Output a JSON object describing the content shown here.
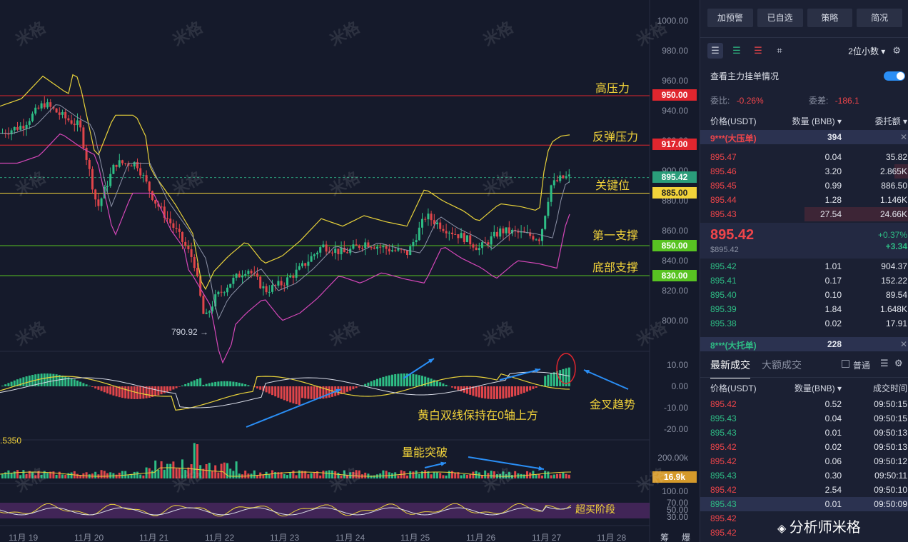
{
  "chart": {
    "price_axis": [
      "1000.00",
      "980.00",
      "960.00",
      "940.00",
      "920.00",
      "900.00",
      "880.00",
      "860.00",
      "840.00",
      "820.00",
      "800.00"
    ],
    "macd_axis": [
      "10.00",
      "0.00",
      "-10.00",
      "-20.00"
    ],
    "vol_axis": [
      "200.00k"
    ],
    "vol_value": "16.9k",
    "rsi_axis": [
      "100.00",
      "70.00",
      "50.00",
      "30.00"
    ],
    "x_labels": [
      "11月 19",
      "11月 20",
      "11月 21",
      "11月 22",
      "11月 23",
      "11月 24",
      "11月 25",
      "11月 26",
      "11月 27",
      "11月 28"
    ],
    "corner_labels": [
      "筹",
      "爆"
    ],
    "low_marker": "790.92 →",
    "left_value": ".5350",
    "levels": [
      {
        "label": "950.00",
        "color": "#e0262e"
      },
      {
        "label": "917.00",
        "color": "#e0262e"
      },
      {
        "label": "895.42",
        "color": "#2a9d7a"
      },
      {
        "label": "885.00",
        "color": "#f2d33a"
      },
      {
        "label": "850.00",
        "color": "#58c322"
      },
      {
        "label": "830.00",
        "color": "#58c322"
      }
    ],
    "annotations": {
      "high_pressure": "高压力",
      "rebound_pressure": "反弹压力",
      "key_level": "关键位",
      "support_one": "第一支撑",
      "support_bottom": "底部支撑",
      "golden_cross": "金叉趋势",
      "double_line": "黄白双线保持在0轴上方",
      "volume_break": "量能突破",
      "overbought": "超买阶段"
    },
    "watermark": "米格",
    "brand_footer": "分析师米格"
  },
  "chart_data": {
    "type": "candlestick",
    "title": "",
    "xlabel": "",
    "ylabel": "",
    "x": [
      "11月 19",
      "11月 20",
      "11月 21",
      "11月 22",
      "11月 23",
      "11月 24",
      "11月 25",
      "11月 26",
      "11月 27"
    ],
    "ylim": [
      790,
      1000
    ],
    "close_last": 895.42,
    "low_marked": 790.92,
    "horizontal_levels": [
      950.0,
      917.0,
      895.42,
      885.0,
      850.0,
      830.0
    ],
    "macd_range": [
      -20,
      10
    ],
    "rsi_levels": [
      100,
      70,
      50,
      30
    ]
  },
  "panel": {
    "buttons": [
      "加预警",
      "已自选",
      "策略",
      "简况"
    ],
    "decimals": "2位小数 ▾",
    "mainforce": "查看主力挂单情况",
    "ratio_label": "委比:",
    "ratio_value": "-0.26%",
    "diff_label": "委差:",
    "diff_value": "-186.1",
    "headers": {
      "price": "价格(USDT)",
      "qty": "数量 (BNB) ▾",
      "total": "委托额 ▾"
    },
    "big_ask": {
      "label": "9***(大压单)",
      "qty": "394"
    },
    "asks": [
      {
        "price": "895.47",
        "qty": "0.04",
        "total": "35.82"
      },
      {
        "price": "895.46",
        "qty": "3.20",
        "total": "2.865K"
      },
      {
        "price": "895.45",
        "qty": "0.99",
        "total": "886.50"
      },
      {
        "price": "895.44",
        "qty": "1.28",
        "total": "1.146K"
      },
      {
        "price": "895.43",
        "qty": "27.54",
        "total": "24.66K"
      }
    ],
    "last_price": "895.42",
    "last_sub": "$895.42",
    "change_pct": "+0.37%",
    "change_abs": "+3.34",
    "bids": [
      {
        "price": "895.42",
        "qty": "1.01",
        "total": "904.37"
      },
      {
        "price": "895.41",
        "qty": "0.17",
        "total": "152.22"
      },
      {
        "price": "895.40",
        "qty": "0.10",
        "total": "89.54"
      },
      {
        "price": "895.39",
        "qty": "1.84",
        "total": "1.648K"
      },
      {
        "price": "895.38",
        "qty": "0.02",
        "total": "17.91"
      }
    ],
    "big_bid": {
      "label": "8***(大托单)",
      "qty": "228"
    },
    "tabs": [
      "最新成交",
      "大额成交"
    ],
    "normal": "普通",
    "trade_headers": {
      "price": "价格(USDT)",
      "qty": "数量(BNB) ▾",
      "time": "成交时间"
    },
    "trades": [
      {
        "price": "895.42",
        "qty": "0.52",
        "time": "09:50:15",
        "side": "red"
      },
      {
        "price": "895.43",
        "qty": "0.04",
        "time": "09:50:15",
        "side": "green"
      },
      {
        "price": "895.43",
        "qty": "0.01",
        "time": "09:50:13",
        "side": "green"
      },
      {
        "price": "895.42",
        "qty": "0.02",
        "time": "09:50:13",
        "side": "red"
      },
      {
        "price": "895.42",
        "qty": "0.06",
        "time": "09:50:12",
        "side": "red"
      },
      {
        "price": "895.43",
        "qty": "0.30",
        "time": "09:50:11",
        "side": "green"
      },
      {
        "price": "895.42",
        "qty": "2.54",
        "time": "09:50:10",
        "side": "red"
      },
      {
        "price": "895.43",
        "qty": "0.01",
        "time": "09:50:09",
        "side": "green"
      },
      {
        "price": "895.42",
        "qty": "",
        "time": "",
        "side": "red"
      },
      {
        "price": "895.42",
        "qty": "",
        "time": "",
        "side": "red"
      }
    ]
  }
}
